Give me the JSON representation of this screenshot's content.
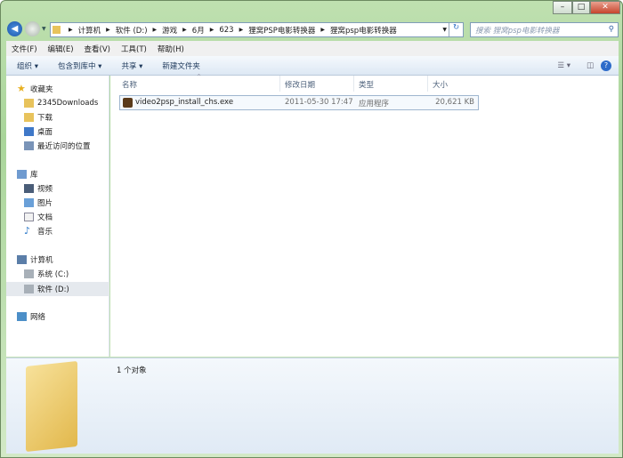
{
  "window": {
    "minimize": "–",
    "maximize": "□",
    "close": "✕"
  },
  "address": {
    "crumbs": [
      "计算机",
      "软件 (D:)",
      "游戏",
      "6月",
      "623",
      "狸窝PSP电影转换器",
      "狸窝psp电影转换器"
    ]
  },
  "search": {
    "placeholder": "搜索 狸窝psp电影转换器"
  },
  "menu": [
    "文件(F)",
    "编辑(E)",
    "查看(V)",
    "工具(T)",
    "帮助(H)"
  ],
  "toolbar": {
    "organize": "组织 ▾",
    "include": "包含到库中 ▾",
    "share": "共享 ▾",
    "new_folder": "新建文件夹"
  },
  "sidebar": {
    "favorites": {
      "label": "收藏夹",
      "items": [
        "2345Downloads",
        "下载",
        "桌面",
        "最近访问的位置"
      ]
    },
    "libraries": {
      "label": "库",
      "items": [
        "视频",
        "图片",
        "文档",
        "音乐"
      ]
    },
    "computer": {
      "label": "计算机",
      "items": [
        "系统 (C:)",
        "软件 (D:)"
      ]
    },
    "network": {
      "label": "网络"
    }
  },
  "columns": [
    "名称",
    "修改日期",
    "类型",
    "大小"
  ],
  "files": [
    {
      "name": "video2psp_install_chs.exe",
      "date": "2011-05-30 17:47",
      "type": "应用程序",
      "size": "20,621 KB"
    }
  ],
  "details": {
    "count": "1 个对象"
  }
}
